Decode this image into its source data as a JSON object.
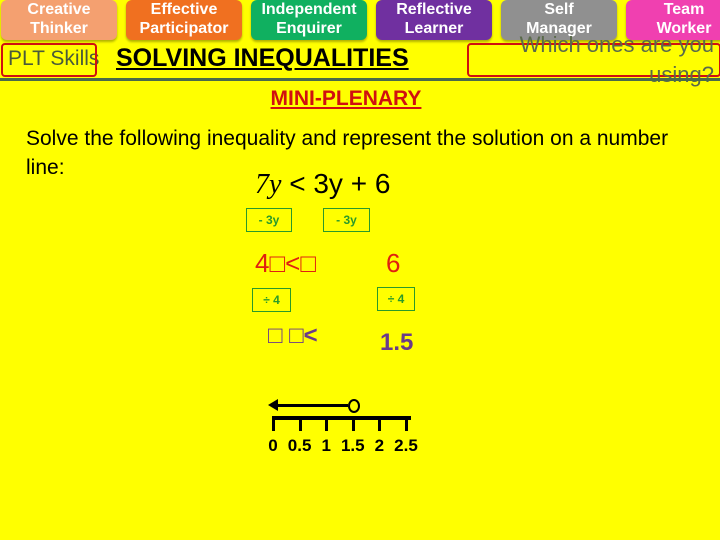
{
  "plt_tiles": [
    {
      "label1": "Creative",
      "label2": "Thinker",
      "color": "#f4a070"
    },
    {
      "label1": "Effective",
      "label2": "Participator",
      "color": "#f07020"
    },
    {
      "label1": "Independent",
      "label2": "Enquirer",
      "color": "#10b060"
    },
    {
      "label1": "Reflective",
      "label2": "Learner",
      "color": "#7030a0"
    },
    {
      "label1": "Self",
      "label2": "Manager",
      "color": "#909090"
    },
    {
      "label1": "Team",
      "label2": "Worker",
      "color": "#f040b0"
    }
  ],
  "header": {
    "plt_label": "PLT Skills",
    "title": "SOLVING INEQUALITIES",
    "question": "Which ones are you using?"
  },
  "subtitle": "MINI-PLENARY",
  "instruction": "Solve the following inequality and represent the solution on a number line:",
  "equation": {
    "lhs": "7y",
    "sign": "<",
    "rhs": "3y + 6"
  },
  "steps": {
    "op1_left": "- 3y",
    "op1_right": "- 3y",
    "line2_left": "4□<□",
    "line2_right": "6",
    "op2_left": "÷ 4",
    "op2_right": "÷ 4",
    "line3_left": "□ □<",
    "line3_right": "1.5"
  },
  "number_line": {
    "ticks": [
      "0",
      "0.5",
      "1",
      "1.5",
      "2",
      "2.5"
    ],
    "open_circle_at": 1.5,
    "direction": "left"
  }
}
